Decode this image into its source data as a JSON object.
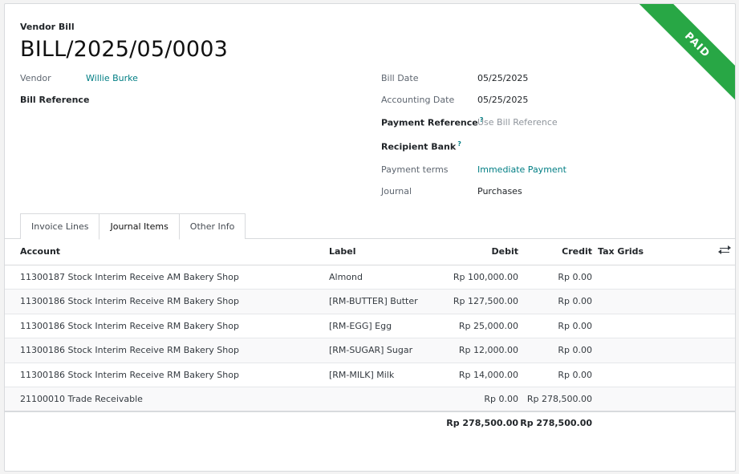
{
  "header": {
    "doc_type": "Vendor Bill",
    "title": "BILL/2025/05/0003",
    "status_ribbon": "PAID",
    "status_color": "#28a745"
  },
  "left_fields": {
    "vendor_label": "Vendor",
    "vendor_value": "Willie Burke",
    "bill_reference_label": "Bill Reference"
  },
  "right_fields": {
    "bill_date_label": "Bill Date",
    "bill_date_value": "05/25/2025",
    "accounting_date_label": "Accounting Date",
    "accounting_date_value": "05/25/2025",
    "payment_reference_label": "Payment Reference",
    "payment_reference_placeholder": "Use Bill Reference",
    "recipient_bank_label": "Recipient Bank",
    "help_mark": "?",
    "payment_terms_label": "Payment terms",
    "payment_terms_value": "Immediate Payment",
    "journal_label": "Journal",
    "journal_value": "Purchases"
  },
  "tabs": [
    {
      "label": "Invoice Lines",
      "active": false
    },
    {
      "label": "Journal Items",
      "active": true
    },
    {
      "label": "Other Info",
      "active": false
    }
  ],
  "table": {
    "columns": {
      "account": "Account",
      "label": "Label",
      "debit": "Debit",
      "credit": "Credit",
      "tax_grids": "Tax Grids"
    },
    "rows": [
      {
        "account": "11300187 Stock Interim Receive AM Bakery Shop",
        "label": "Almond",
        "debit": "Rp 100,000.00",
        "credit": "Rp 0.00"
      },
      {
        "account": "11300186 Stock Interim Receive RM Bakery Shop",
        "label": "[RM-BUTTER] Butter",
        "debit": "Rp 127,500.00",
        "credit": "Rp 0.00"
      },
      {
        "account": "11300186 Stock Interim Receive RM Bakery Shop",
        "label": "[RM-EGG] Egg",
        "debit": "Rp 25,000.00",
        "credit": "Rp 0.00"
      },
      {
        "account": "11300186 Stock Interim Receive RM Bakery Shop",
        "label": "[RM-SUGAR] Sugar",
        "debit": "Rp 12,000.00",
        "credit": "Rp 0.00"
      },
      {
        "account": "11300186 Stock Interim Receive RM Bakery Shop",
        "label": "[RM-MILK] Milk",
        "debit": "Rp 14,000.00",
        "credit": "Rp 0.00"
      },
      {
        "account": "21100010 Trade Receivable",
        "label": "",
        "debit": "Rp 0.00",
        "credit": "Rp 278,500.00"
      }
    ],
    "totals": {
      "debit": "Rp 278,500.00",
      "credit": "Rp 278,500.00"
    }
  },
  "icons": {
    "optional_columns": "sliders-icon"
  }
}
